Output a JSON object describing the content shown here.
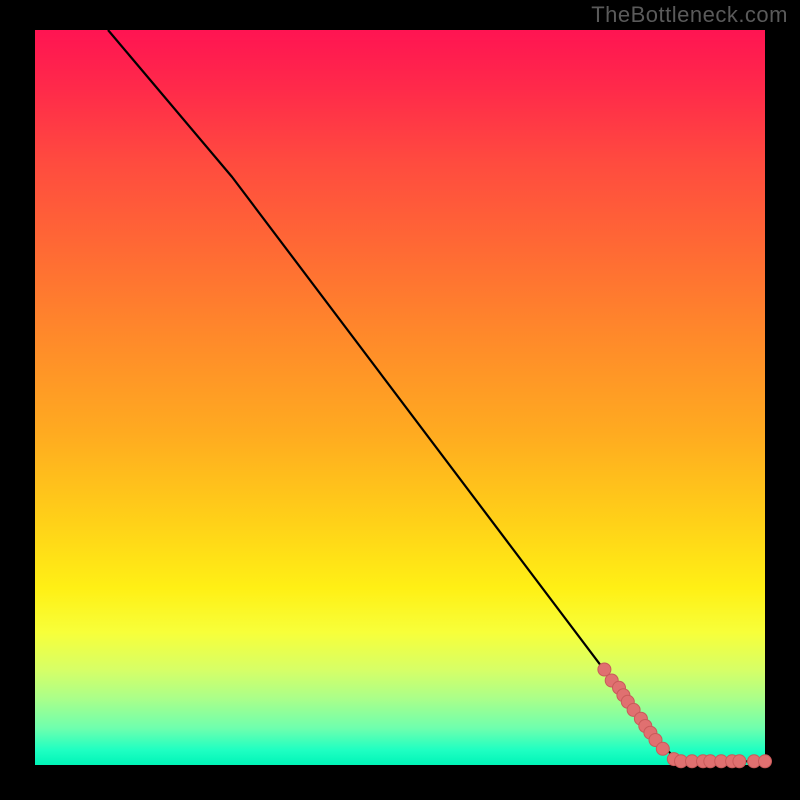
{
  "watermark": "TheBottleneck.com",
  "chart_data": {
    "type": "line",
    "title": "",
    "xlabel": "",
    "ylabel": "",
    "xlim": [
      0,
      100
    ],
    "ylim": [
      0,
      100
    ],
    "grid": false,
    "colors": {
      "gradient_top": "#ff1452",
      "gradient_mid1": "#ff8a2a",
      "gradient_mid2": "#fff015",
      "gradient_bottom": "#00f5b8",
      "line": "#000000",
      "marker_fill": "#e07070",
      "marker_stroke": "#c85a5a"
    },
    "series": [
      {
        "name": "bottleneck-curve",
        "x": [
          10,
          27,
          84,
          88,
          100
        ],
        "y": [
          100,
          80,
          5,
          0.5,
          0.5
        ]
      }
    ],
    "markers": {
      "name": "highlighted-points",
      "points": [
        {
          "x": 78,
          "y": 13
        },
        {
          "x": 79,
          "y": 11.5
        },
        {
          "x": 80,
          "y": 10.5
        },
        {
          "x": 80.6,
          "y": 9.5
        },
        {
          "x": 81.2,
          "y": 8.6
        },
        {
          "x": 82,
          "y": 7.5
        },
        {
          "x": 83,
          "y": 6.3
        },
        {
          "x": 83.6,
          "y": 5.3
        },
        {
          "x": 84.3,
          "y": 4.4
        },
        {
          "x": 85,
          "y": 3.4
        },
        {
          "x": 86,
          "y": 2.2
        },
        {
          "x": 87.5,
          "y": 0.8
        },
        {
          "x": 88.5,
          "y": 0.5
        },
        {
          "x": 90,
          "y": 0.5
        },
        {
          "x": 91.5,
          "y": 0.5
        },
        {
          "x": 92.5,
          "y": 0.5
        },
        {
          "x": 94,
          "y": 0.5
        },
        {
          "x": 95.5,
          "y": 0.5
        },
        {
          "x": 96.5,
          "y": 0.5
        },
        {
          "x": 98.5,
          "y": 0.5
        },
        {
          "x": 100,
          "y": 0.5
        }
      ]
    }
  }
}
